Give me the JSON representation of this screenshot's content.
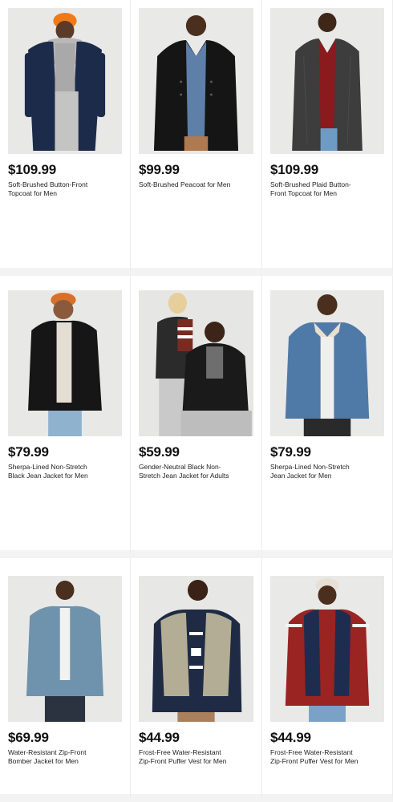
{
  "products": [
    {
      "price": "$109.99",
      "name": "Soft-Brushed Button-Front Topcoat for Men",
      "image": "man-navy-topcoat-orange-beanie"
    },
    {
      "price": "$99.99",
      "name": "Soft-Brushed Peacoat for Men",
      "image": "man-black-peacoat-denim-shirt"
    },
    {
      "price": "$109.99",
      "name": "Soft-Brushed Plaid Button-Front Topcoat for Men",
      "image": "man-gray-plaid-topcoat"
    },
    {
      "price": "$79.99",
      "name": "Sherpa-Lined Non-Stretch Black Jean Jacket for Men",
      "image": "man-black-jean-jacket-orange-beanie"
    },
    {
      "price": "$59.99",
      "name": "Gender-Neutral Black Non-Stretch Jean Jacket for Adults",
      "image": "two-adults-black-jean-jackets"
    },
    {
      "price": "$79.99",
      "name": "Sherpa-Lined Non-Stretch Jean Jacket for Men",
      "image": "man-blue-sherpa-jean-jacket"
    },
    {
      "price": "$69.99",
      "name": "Water-Resistant Zip-Front Bomber Jacket for Men",
      "image": "man-blue-bomber-jacket"
    },
    {
      "price": "$44.99",
      "name": "Frost-Free Water-Resistant Zip-Front Puffer Vest for Men",
      "image": "man-beige-puffer-vest-fairisle-sweater"
    },
    {
      "price": "$44.99",
      "name": "Frost-Free Water-Resistant Zip-Front Puffer Vest for Men",
      "image": "man-navy-puffer-vest-red-sweater"
    }
  ],
  "colors": {
    "page_bg": "#f3f3f3",
    "card_bg": "#ffffff",
    "photo_bg": "#e6e6e4",
    "price": "#111111"
  }
}
